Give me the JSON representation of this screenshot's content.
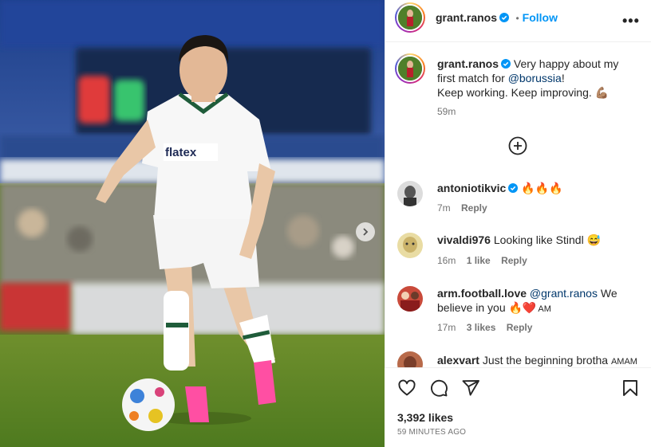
{
  "post": {
    "author": "grant.ranos",
    "follow_label": "Follow",
    "dot_separator": "•",
    "more_label": "•••",
    "caption_lines": [
      "Very happy about my",
      "first match for ",
      "!",
      "Keep working. Keep improving. 💪🏽"
    ],
    "caption_mention": "@borussia",
    "caption_time": "59m",
    "likes": "3,392 likes",
    "time_ago": "59 MINUTES AGO"
  },
  "media": {
    "jersey_sponsor": "flatex",
    "next_icon": "chevron-right-icon"
  },
  "comments": [
    {
      "user": "antoniotikvic",
      "text": "🔥🔥🔥",
      "time": "7m",
      "likes": "",
      "reply": "Reply",
      "verified": true
    },
    {
      "user": "vivaldi976",
      "text": "Looking like Stindl 😅",
      "time": "16m",
      "likes": "1 like",
      "reply": "Reply",
      "verified": false
    },
    {
      "user": "arm.football.love",
      "mention": "@grant.ranos",
      "text1": " We",
      "text2": "believe in you 🔥❤️",
      "suffix": "AM",
      "time": "17m",
      "likes": "3 likes",
      "reply": "Reply",
      "verified": false
    },
    {
      "user": "alexvart",
      "text": "Just the beginning brotha",
      "suffix": "AMAM",
      "verified": false
    }
  ],
  "actions": {
    "like_icon": "heart-icon",
    "comment_icon": "comment-icon",
    "share_icon": "share-icon",
    "save_icon": "bookmark-icon",
    "add_comment_icon": "plus-circle-icon"
  },
  "colors": {
    "accent": "#0095f6",
    "verified": "#0095f6",
    "muted": "#737373"
  }
}
